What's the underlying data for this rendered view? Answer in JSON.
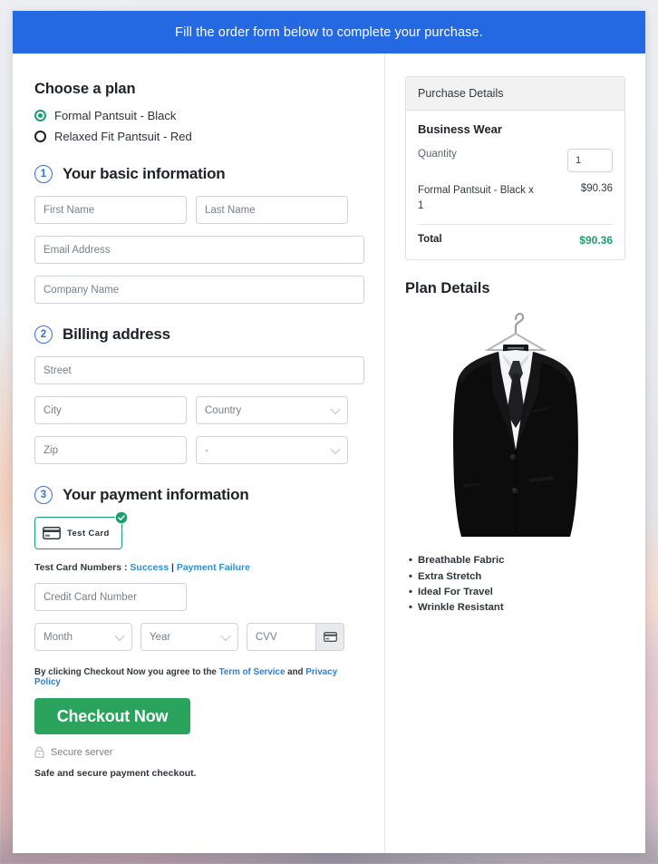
{
  "banner": {
    "text": "Fill the order form below to complete your purchase."
  },
  "plan": {
    "title": "Choose a plan",
    "options": [
      {
        "label": "Formal Pantsuit - Black",
        "selected": true
      },
      {
        "label": "Relaxed Fit Pantsuit - Red",
        "selected": false
      }
    ]
  },
  "step1": {
    "number": "1",
    "title": "Your basic information",
    "first_name_placeholder": "First Name",
    "last_name_placeholder": "Last Name",
    "email_placeholder": "Email Address",
    "company_placeholder": "Company Name"
  },
  "step2": {
    "number": "2",
    "title": "Billing address",
    "street_placeholder": "Street",
    "city_placeholder": "City",
    "country_placeholder": "Country",
    "zip_placeholder": "Zip",
    "state_placeholder": "-"
  },
  "step3": {
    "number": "3",
    "title": "Your payment information",
    "method_label": "Test  Card",
    "testcard_prefix": "Test Card Numbers : ",
    "testcard_success": "Success",
    "testcard_separator": " | ",
    "testcard_failure": "Payment Failure",
    "card_number_placeholder": "Credit Card Number",
    "month_placeholder": "Month",
    "year_placeholder": "Year",
    "cvv_placeholder": "CVV"
  },
  "footer": {
    "agree_prefix": "By clicking Checkout Now you agree to the ",
    "terms_link": "Term of Service",
    "agree_middle": " and ",
    "privacy_link": "Privacy Policy",
    "checkout_label": "Checkout Now",
    "secure_label": "Secure server",
    "safe_note": "Safe and secure payment checkout."
  },
  "purchase": {
    "header": "Purchase Details",
    "plan_name": "Business Wear",
    "quantity_label": "Quantity",
    "quantity_value": "1",
    "item_name": "Formal Pantsuit - Black x 1",
    "item_price": "$90.36",
    "total_label": "Total",
    "total_value": "$90.36"
  },
  "plan_details": {
    "title": "Plan Details",
    "image_alt": "black-suit-on-hanger",
    "features": [
      "Breathable Fabric",
      "Extra Stretch",
      "Ideal For Travel",
      "Wrinkle Resistant"
    ]
  },
  "colors": {
    "banner_blue": "#2468e2",
    "accent_green": "#1aa06d",
    "button_green": "#2aa35c",
    "step_blue": "#2f6fe0",
    "link_blue": "#2a8fd8"
  }
}
